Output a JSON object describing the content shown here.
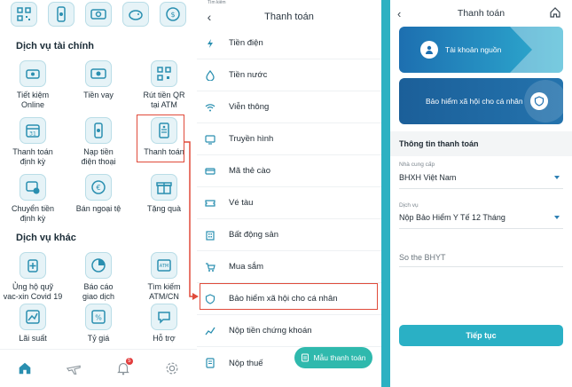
{
  "home": {
    "sections": {
      "financial_title": "Dịch vụ tài chính",
      "other_title": "Dịch vụ khác"
    },
    "financial_services": [
      {
        "label": "Tiết kiệm\nOnline",
        "icon": "piggy-bank-icon"
      },
      {
        "label": "Tiền vay",
        "icon": "money-icon"
      },
      {
        "label": "Rút tiền QR\ntại ATM",
        "icon": "qr-icon"
      },
      {
        "label": "Thanh toán\nđịnh kỳ",
        "icon": "calendar-icon"
      },
      {
        "label": "Nạp tiền\nđiện thoại",
        "icon": "phone-icon"
      },
      {
        "label": "Thanh toán",
        "icon": "bill-icon"
      },
      {
        "label": "Chuyển tiền\nđịnh kỳ",
        "icon": "transfer-icon"
      },
      {
        "label": "Bán ngoại tệ",
        "icon": "currency-icon"
      },
      {
        "label": "Tặng quà",
        "icon": "gift-icon"
      }
    ],
    "other_services": [
      {
        "label": "Ủng hộ quỹ\nvac-xin Covid 19",
        "icon": "donate-icon"
      },
      {
        "label": "Báo cáo\ngiao dịch",
        "icon": "report-icon"
      },
      {
        "label": "Tìm kiếm\nATM/CN",
        "icon": "atm-icon"
      },
      {
        "label": "Lãi suất",
        "icon": "chart-icon"
      },
      {
        "label": "Tỷ giá",
        "icon": "percent-icon"
      },
      {
        "label": "Hỗ trợ",
        "icon": "support-icon"
      }
    ],
    "notification_count": "5"
  },
  "payment": {
    "status_text": "Tìm kiếm",
    "title": "Thanh toán",
    "items": [
      {
        "label": "Tiền điện",
        "icon": "lightning-icon"
      },
      {
        "label": "Tiền nước",
        "icon": "water-drop-icon"
      },
      {
        "label": "Viễn thông",
        "icon": "wifi-icon"
      },
      {
        "label": "Truyền hình",
        "icon": "tv-icon"
      },
      {
        "label": "Mã thẻ cào",
        "icon": "card-icon"
      },
      {
        "label": "Vé tàu",
        "icon": "ticket-icon"
      },
      {
        "label": "Bất động sản",
        "icon": "building-icon"
      },
      {
        "label": "Mua sắm",
        "icon": "cart-icon"
      },
      {
        "label": "Bảo hiểm xã hội cho cá nhân",
        "icon": "shield-icon"
      },
      {
        "label": "Nộp tiền chứng khoán",
        "icon": "stock-icon"
      },
      {
        "label": "Nộp thuế",
        "icon": "tax-icon"
      }
    ],
    "fab_label": "Mẫu thanh toán"
  },
  "insurance": {
    "title": "Thanh toán",
    "source_account_label": "Tài khoản nguồn",
    "service_card_label": "Bảo hiểm xã hội cho cá nhân",
    "info_title": "Thông tin thanh toán",
    "provider_label": "Nhà cung cấp",
    "provider_value": "BHXH Việt Nam",
    "service_label": "Dịch vụ",
    "service_value": "Nộp Bảo Hiểm Y Tế 12 Tháng",
    "bhyt_placeholder": "So the BHYT",
    "continue_label": "Tiếp tục"
  },
  "colors": {
    "accent": "#2db1c2",
    "highlight": "#e04a3a",
    "card_blue": "#1d6fb0"
  }
}
